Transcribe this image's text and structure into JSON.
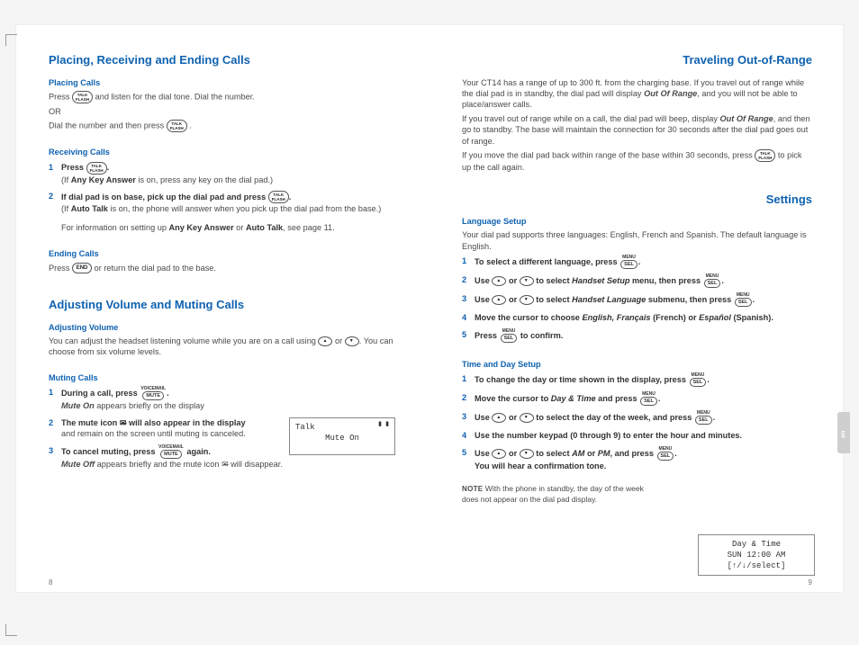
{
  "left": {
    "h_placing": "Placing, Receiving and Ending Calls",
    "sub_placing": "Placing Calls",
    "placing_l1a": "Press ",
    "placing_l1b": " and listen for the dial tone. Dial the number.",
    "placing_or": "OR",
    "placing_l2a": "Dial the number and then press ",
    "placing_l2b": ".",
    "sub_receiving": "Receiving Calls",
    "recv_1a": "Press ",
    "recv_1b": ".",
    "recv_1note_a": "(If ",
    "recv_1note_b": "Any Key Answer",
    "recv_1note_c": " is on, press any key on the dial pad.)",
    "recv_2a": "If dial pad is on base, pick up the dial pad and press ",
    "recv_2b": ".",
    "recv_2note_a": "(If ",
    "recv_2note_b": "Auto Talk",
    "recv_2note_c": " is on, the phone will answer when you pick up the dial pad from the base.)",
    "recv_info_a": "For information on setting up ",
    "recv_info_b": "Any Key Answer",
    "recv_info_c": " or ",
    "recv_info_d": "Auto Talk",
    "recv_info_e": ", see page 11.",
    "sub_ending": "Ending Calls",
    "end_a": "Press ",
    "end_b": " or return the dial pad to the base.",
    "h_adjust": "Adjusting Volume and Muting Calls",
    "sub_adjvol": "Adjusting Volume",
    "adj_a": "You can adjust the headset listening volume while you are on a call using ",
    "adj_b": " or ",
    "adj_c": ". You can choose from six volume levels.",
    "sub_muting": "Muting Calls",
    "mute_1a": "During a call, press ",
    "mute_1b": ".",
    "mute_1c_i": "Mute On",
    "mute_1c_t": " appears briefly on the display",
    "mute_2a": "The mute icon ",
    "mute_2b": " will also appear in the display",
    "mute_2c": "and remain on the screen until muting is canceled.",
    "mute_3a": "To cancel muting, press ",
    "mute_3b": " again.",
    "mute_3c_i": "Mute Off",
    "mute_3c_t1": " appears briefly and the mute icon ",
    "mute_3c_t2": " will disappear.",
    "lcd_line1": "Talk",
    "lcd_line2": "Mute On",
    "pagenum": "8",
    "btn_talk1": "TALK",
    "btn_talk1b": "FLASH",
    "btn_end": "END",
    "btn_mute1": "VOICEMAIL",
    "btn_mute2": "MUTE"
  },
  "right": {
    "h_travel": "Traveling Out-of-Range",
    "trav_p1a": "Your CT14 has a range of up to 300 ft. from the charging base. If you travel out of range while the dial pad is in standby, the dial pad will display ",
    "trav_p1b": "Out Of Range",
    "trav_p1c": ", and you will not be able to place/answer calls.",
    "trav_p2a": "If you travel out of range while on a call, the dial pad will beep, display ",
    "trav_p2b": "Out Of Range",
    "trav_p2c": ", and then go to standby. The base will maintain the connection for 30 seconds after the dial pad goes out of range.",
    "trav_p3a": "If you move the dial pad back within range of the base within 30 seconds, press ",
    "trav_p3b": " to pick up the call again.",
    "h_settings": "Settings",
    "sub_lang": "Language Setup",
    "lang_intro": "Your dial pad supports three languages: English, French and Spanish. The default language is English.",
    "lang_1a": "To select a different language, press ",
    "lang_1b": ".",
    "lang_2a": "Use ",
    "lang_2b": " or ",
    "lang_2c": " to select ",
    "lang_2d": "Handset Setup",
    "lang_2e": " menu, then press ",
    "lang_2f": ".",
    "lang_3a": "Use ",
    "lang_3b": " or ",
    "lang_3c": " to select ",
    "lang_3d": "Handset Language",
    "lang_3e": " submenu, then press ",
    "lang_3f": ".",
    "lang_4a": "Move the cursor to choose ",
    "lang_4b": "English, Français",
    "lang_4c": " (French) or ",
    "lang_4d": "Español",
    "lang_4e": " (Spanish).",
    "lang_5a": "Press ",
    "lang_5b": " to confirm.",
    "sub_time": "Time and Day Setup",
    "time_1a": "To change the day or time shown in the display, press ",
    "time_1b": ".",
    "time_2a": "Move the cursor to ",
    "time_2b": "Day & Time",
    "time_2c": " and press ",
    "time_2d": ".",
    "time_3a": "Use ",
    "time_3b": " or ",
    "time_3c": " to select the day of the week, and press ",
    "time_3d": ".",
    "time_4": "Use the number keypad (0 through 9) to enter the hour and minutes.",
    "time_5a": "Use ",
    "time_5b": " or ",
    "time_5c": " to select ",
    "time_5d": "AM",
    "time_5e": " or ",
    "time_5f": "PM",
    "time_5g": ", and press ",
    "time_5h": ".",
    "time_5i": "You will hear a confirmation tone.",
    "note_lbl": "NOTE",
    "note_txt": "  With the phone in standby, the day of the week does not appear on the dial pad display.",
    "lcd_l1": "Day & Time",
    "lcd_l2": "SUN 12:00 AM",
    "lcd_l3": "[↑/↓/select]",
    "pagenum": "9",
    "menu": "MENU",
    "sel": "SEL",
    "tab": "en"
  }
}
